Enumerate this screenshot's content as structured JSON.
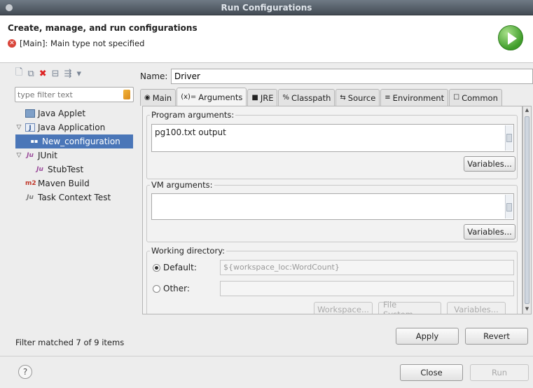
{
  "window": {
    "title": "Run Configurations"
  },
  "header": {
    "title": "Create, manage, and run configurations",
    "message": "[Main]: Main type not specified",
    "error_icon": "error-icon",
    "run_icon": "run-icon"
  },
  "left": {
    "filter_placeholder": "type filter text",
    "tree": [
      {
        "label": "Java Applet",
        "icon": "J"
      },
      {
        "label": "Java Application",
        "icon": "J"
      },
      {
        "label": "New_configuration",
        "icon": "●"
      },
      {
        "label": "JUnit",
        "icon": "Ju"
      },
      {
        "label": "StubTest",
        "icon": "Ju"
      },
      {
        "label": "Maven Build",
        "icon": "m2"
      },
      {
        "label": "Task Context Test",
        "icon": "Ju"
      }
    ],
    "status": "Filter matched 7 of 9 items"
  },
  "config": {
    "name_label": "Name:",
    "name_value": "Driver",
    "tabs": [
      "Main",
      "Arguments",
      "JRE",
      "Classpath",
      "Source",
      "Environment",
      "Common"
    ],
    "tab_icons": [
      "◉",
      "(x)=",
      "■",
      "%",
      "⇆",
      "≡",
      "☐"
    ],
    "program_args_label": "Program arguments:",
    "program_args_value": "pg100.txt output",
    "variables_label": "Variables...",
    "vm_args_label": "VM arguments:",
    "vm_args_value": "",
    "working_dir_label": "Working directory:",
    "default_label": "Default:",
    "default_value": "${workspace_loc:WordCount}",
    "other_label": "Other:",
    "other_value": "",
    "workspace_btn": "Workspace...",
    "filesystem_btn": "File System...",
    "variables_btn2": "Variables..."
  },
  "buttons": {
    "apply": "Apply",
    "revert": "Revert",
    "close": "Close",
    "run": "Run",
    "help": "?"
  }
}
